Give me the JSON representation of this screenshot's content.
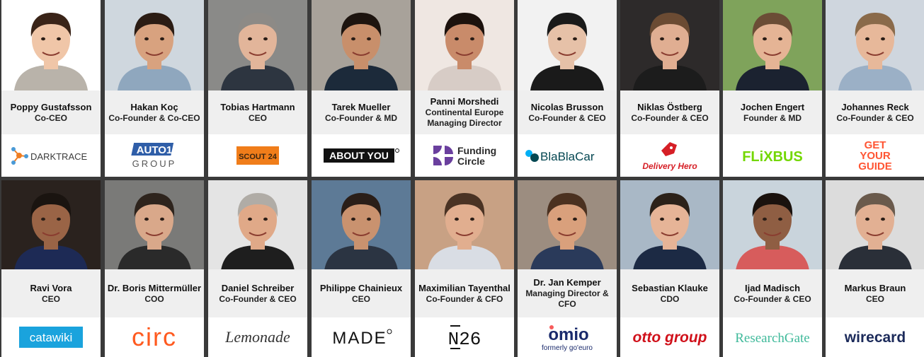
{
  "row1": [
    {
      "name": "Poppy Gustafsson",
      "role": "Co-CEO",
      "logo": "DARKTRACE",
      "bg": "#ffffff",
      "skin": "#f0c6a8",
      "hair": "#3a2418",
      "shirt": "#b9b3aa"
    },
    {
      "name": "Hakan Koç",
      "role": "Co-Founder & Co-CEO",
      "logo": "AUTO1",
      "logo2": "GROUP",
      "bg": "#cfd7de",
      "skin": "#d8a27f",
      "hair": "#2b1c14",
      "shirt": "#8fa7be"
    },
    {
      "name": "Tobias Hartmann",
      "role": "CEO",
      "logo": "SCOUT 24",
      "bg": "#8a8a88",
      "skin": "#e2b59a",
      "hair": "#8d8a86",
      "shirt": "#2d3540"
    },
    {
      "name": "Tarek Mueller",
      "role": "Co-Founder & MD",
      "logo": "ABOUT YOU",
      "bg": "#a8a29a",
      "skin": "#c88f6b",
      "hair": "#1d140f",
      "shirt": "#1c2a3a"
    },
    {
      "name": "Panni Morshedi",
      "role": "Continental Europe Managing Director",
      "logo": "Funding",
      "logo2": "Circle",
      "bg": "#efe7e2",
      "skin": "#c98b6a",
      "hair": "#1c120d",
      "shirt": "#d7ccc6"
    },
    {
      "name": "Nicolas Brusson",
      "role": "Co-Founder & CEO",
      "logo": "BlaBlaCar",
      "bg": "#f2f2f2",
      "skin": "#e6c1a8",
      "hair": "#1a1a1a",
      "shirt": "#1a1a1a"
    },
    {
      "name": "Niklas Östberg",
      "role": "Co-Founder & CEO",
      "logo": "Delivery Hero",
      "bg": "#2d2a2a",
      "skin": "#e0ae92",
      "hair": "#6b4b33",
      "shirt": "#1c1c1c"
    },
    {
      "name": "Jochen Engert",
      "role": "Founder & MD",
      "logo": "FLiXBUS",
      "bg": "#7fa35b",
      "skin": "#e5b495",
      "hair": "#6b4d36",
      "shirt": "#1b2230"
    },
    {
      "name": "Johannes Reck",
      "role": "Co-Founder & CEO",
      "logo": "GET",
      "logo2": "YOUR",
      "logo3": "GUIDE",
      "bg": "#cfd6de",
      "skin": "#e7b89a",
      "hair": "#8a6a4a",
      "shirt": "#9bb0c6"
    }
  ],
  "row2": [
    {
      "name": "Ravi Vora",
      "role": "CEO",
      "logo": "catawiki",
      "bg": "#2a221e",
      "skin": "#9a6446",
      "hair": "#1a1410",
      "shirt": "#1d2a55"
    },
    {
      "name": "Dr.  Boris Mittermüller",
      "role": "COO",
      "logo": "circ",
      "bg": "#7a7a78",
      "skin": "#d9a88a",
      "hair": "#2e241d",
      "shirt": "#2a2a2a"
    },
    {
      "name": "Daniel Schreiber",
      "role": "Co-Founder & CEO",
      "logo": "Lemonade",
      "bg": "#e4e4e4",
      "skin": "#e0a988",
      "hair": "#b0aca6",
      "shirt": "#1e1e1e"
    },
    {
      "name": "Philippe Chainieux",
      "role": "CEO",
      "logo": "MADE",
      "bg": "#5d7a96",
      "skin": "#c9926f",
      "hair": "#2a1e18",
      "shirt": "#2b3442"
    },
    {
      "name": "Maximilian Tayenthal",
      "role": "Co-Founder & CFO",
      "logo": "N26",
      "bg": "#c8a184",
      "skin": "#e1ae8f",
      "hair": "#4a3324",
      "shirt": "#d9dde4"
    },
    {
      "name": "Dr. Jan Kemper",
      "role": "Managing Director & CFO",
      "logo": "omio",
      "logo2": "formerly go'euro",
      "bg": "#9c8d80",
      "skin": "#d9a07c",
      "hair": "#4b3120",
      "shirt": "#2a3a5a"
    },
    {
      "name": "Sebastian Klauke",
      "role": "CDO",
      "logo": "otto group",
      "bg": "#a9b8c6",
      "skin": "#e6b497",
      "hair": "#2b2119",
      "shirt": "#1c2a44"
    },
    {
      "name": "Ijad Madisch",
      "role": "Co-Founder & CEO",
      "logo": "ResearchGate",
      "bg": "#c9d4dc",
      "skin": "#8f5e43",
      "hair": "#1a120e",
      "shirt": "#d75c5c"
    },
    {
      "name": "Markus Braun",
      "role": "CEO",
      "logo": "wirecard",
      "bg": "#dcdcdc",
      "skin": "#e2b093",
      "hair": "#6a5a4c",
      "shirt": "#2a2f38"
    }
  ],
  "colors": {
    "darktrace": "#3b3b3b",
    "auto1": "#2f5ea8",
    "scout": "#f07d1a",
    "funding": "#5a3b8f",
    "blabla": "#054752",
    "delivery": "#d61f26",
    "flixbus": "#73d700",
    "gyg": "#ff5533",
    "catawiki": "#1aa3dd",
    "circ": "#ff5a1f",
    "omio": "#1a2a6c",
    "otto": "#d0101a",
    "researchgate": "#40ba9b",
    "wirecard": "#1b2a5a"
  }
}
